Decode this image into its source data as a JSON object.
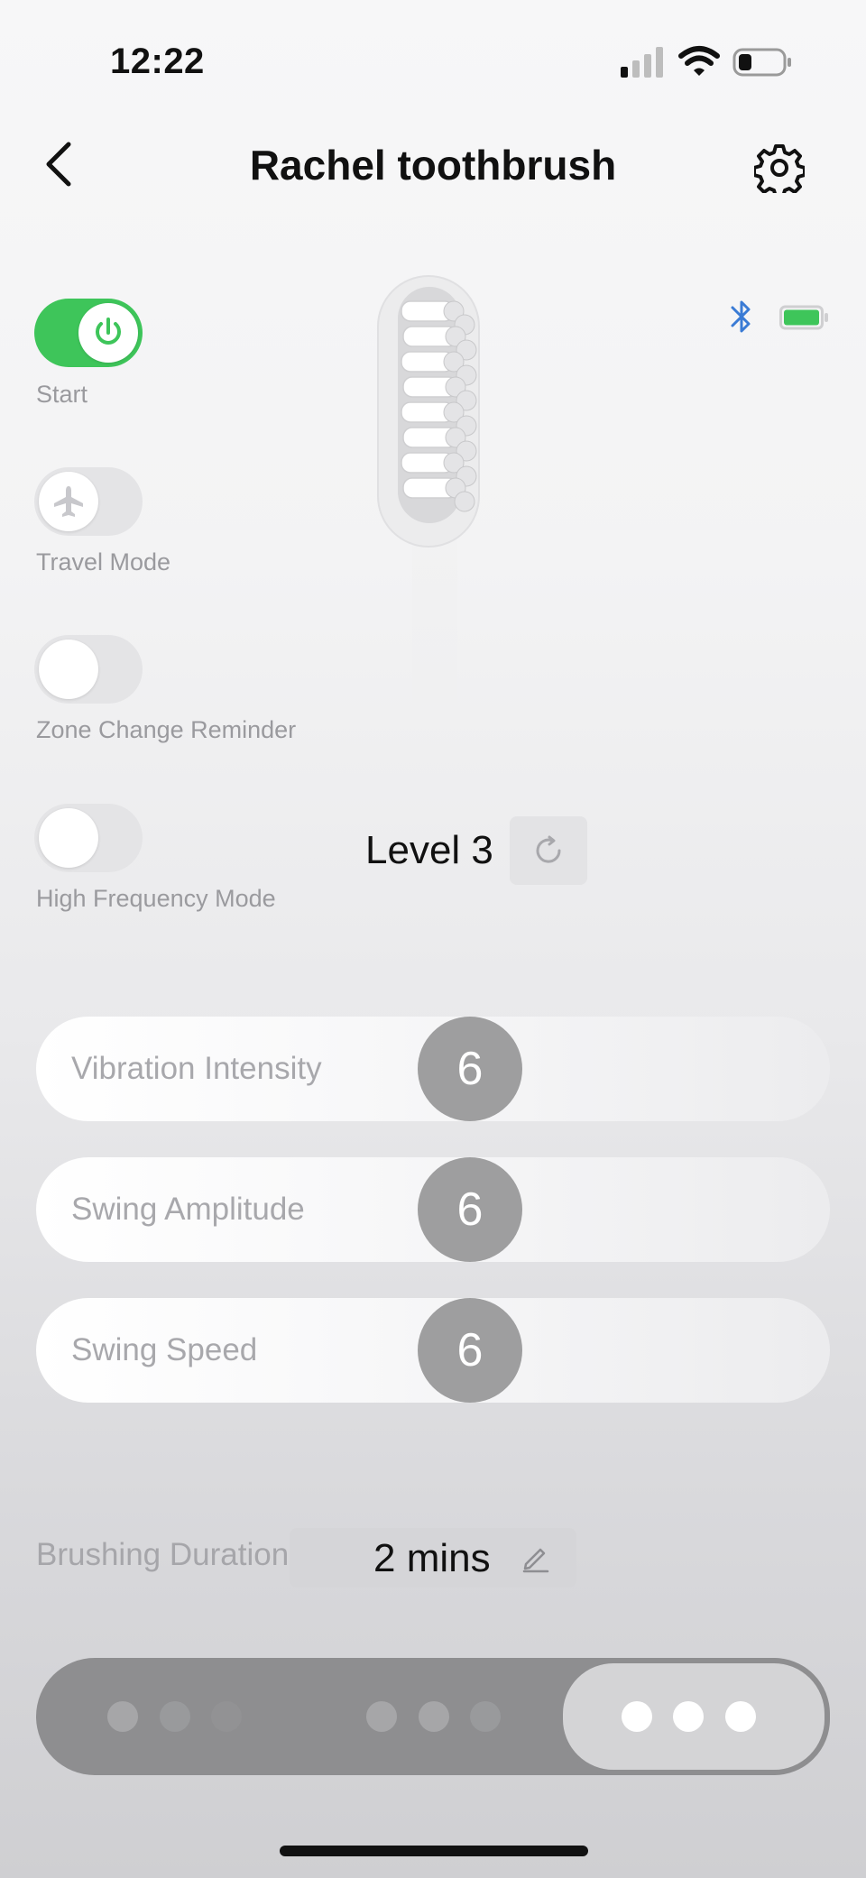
{
  "status_bar": {
    "time": "12:22"
  },
  "header": {
    "title": "Rachel toothbrush"
  },
  "toggles": [
    {
      "label": "Start",
      "on": true,
      "icon": "power-icon"
    },
    {
      "label": "Travel Mode",
      "on": false,
      "icon": "airplane-icon"
    },
    {
      "label": "Zone Change Reminder",
      "on": false
    },
    {
      "label": "High Frequency Mode",
      "on": false
    }
  ],
  "level": {
    "text": "Level 3"
  },
  "sliders": [
    {
      "label": "Vibration Intensity",
      "value": "6"
    },
    {
      "label": "Swing Amplitude",
      "value": "6"
    },
    {
      "label": "Swing Speed",
      "value": "6"
    }
  ],
  "duration": {
    "label": "Brushing Duration",
    "value": "2 mins"
  },
  "modes": {
    "selected_index": 2
  },
  "colors": {
    "accent_green": "#3ec55a",
    "bluetooth_blue": "#3a7bd5",
    "thumb_gray": "#9e9e9f"
  }
}
